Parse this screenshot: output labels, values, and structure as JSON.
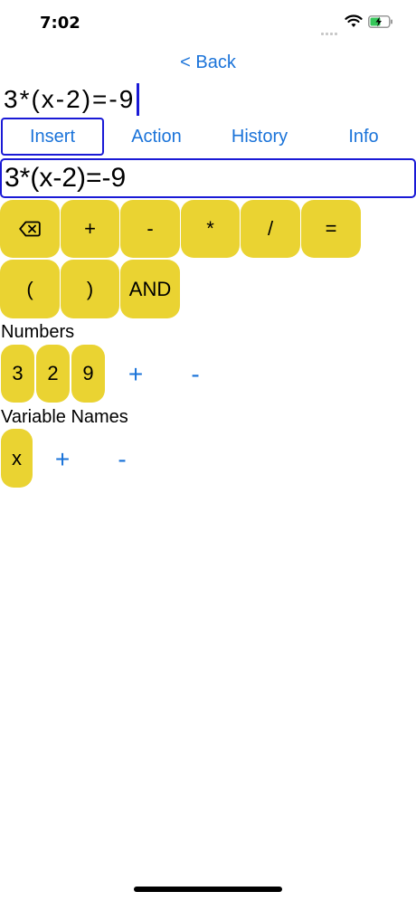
{
  "status_bar": {
    "time": "7:02"
  },
  "navigation": {
    "back_label": "< Back"
  },
  "expression": {
    "display": "3*(x-2)=-9",
    "field_value": "3*(x-2)=-9"
  },
  "tabs": [
    {
      "label": "Insert"
    },
    {
      "label": "Action"
    },
    {
      "label": "History"
    },
    {
      "label": "Info"
    }
  ],
  "operator_keys": {
    "row1": [
      "⌫",
      "+",
      "-",
      "*",
      "/",
      "="
    ],
    "row2": [
      "(",
      ")",
      "AND"
    ]
  },
  "numbers": {
    "label": "Numbers",
    "keys": [
      "3",
      "2",
      "9"
    ],
    "add_label": "+",
    "remove_label": "-"
  },
  "variables": {
    "label": "Variable Names",
    "keys": [
      "x"
    ],
    "add_label": "+",
    "remove_label": "-"
  },
  "colors": {
    "key": "#ead332",
    "accent": "#1a73d9",
    "border": "#1a1ad6"
  }
}
